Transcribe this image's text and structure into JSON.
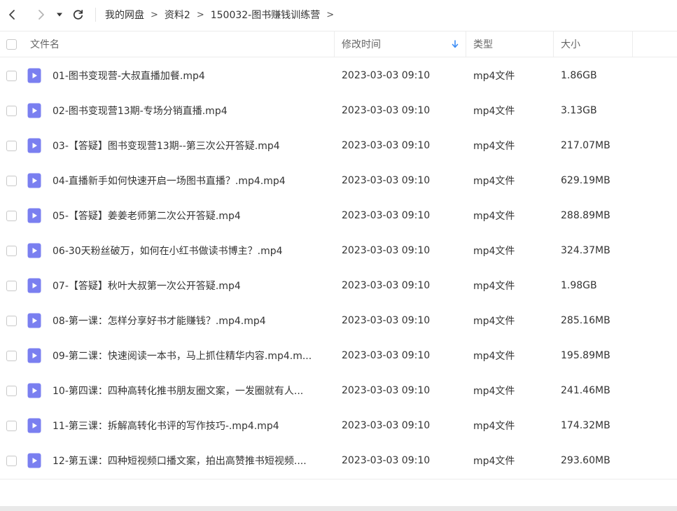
{
  "breadcrumb": [
    "我的网盘",
    "资料2",
    "150032-图书赚钱训练营"
  ],
  "breadcrumb_separator": ">",
  "columns": {
    "name": "文件名",
    "modified": "修改时间",
    "type": "类型",
    "size": "大小"
  },
  "sort": {
    "column": "modified",
    "direction": "descending",
    "indicator_color": "#3b8cf5"
  },
  "icon_color": "#7a7ff0",
  "files": [
    {
      "name": "01-图书变现营-大叔直播加餐.mp4",
      "modified": "2023-03-03 09:10",
      "type": "mp4文件",
      "size": "1.86GB"
    },
    {
      "name": "02-图书变现营13期-专场分销直播.mp4",
      "modified": "2023-03-03 09:10",
      "type": "mp4文件",
      "size": "3.13GB"
    },
    {
      "name": "03-【答疑】图书变现营13期--第三次公开答疑.mp4",
      "modified": "2023-03-03 09:10",
      "type": "mp4文件",
      "size": "217.07MB"
    },
    {
      "name": "04-直播新手如何快速开启一场图书直播？.mp4.mp4",
      "modified": "2023-03-03 09:10",
      "type": "mp4文件",
      "size": "629.19MB"
    },
    {
      "name": "05-【答疑】姜姜老师第二次公开答疑.mp4",
      "modified": "2023-03-03 09:10",
      "type": "mp4文件",
      "size": "288.89MB"
    },
    {
      "name": "06-30天粉丝破万，如何在小红书做读书博主？.mp4",
      "modified": "2023-03-03 09:10",
      "type": "mp4文件",
      "size": "324.37MB"
    },
    {
      "name": "07-【答疑】秋叶大叔第一次公开答疑.mp4",
      "modified": "2023-03-03 09:10",
      "type": "mp4文件",
      "size": "1.98GB"
    },
    {
      "name": "08-第一课：怎样分享好书才能赚钱？.mp4.mp4",
      "modified": "2023-03-03 09:10",
      "type": "mp4文件",
      "size": "285.16MB"
    },
    {
      "name": "09-第二课：快速阅读一本书，马上抓住精华内容.mp4.m...",
      "modified": "2023-03-03 09:10",
      "type": "mp4文件",
      "size": "195.89MB"
    },
    {
      "name": "10-第四课：四种高转化推书朋友圈文案，一发圈就有人...",
      "modified": "2023-03-03 09:10",
      "type": "mp4文件",
      "size": "241.46MB"
    },
    {
      "name": "11-第三课：拆解高转化书评的写作技巧-.mp4.mp4",
      "modified": "2023-03-03 09:10",
      "type": "mp4文件",
      "size": "174.32MB"
    },
    {
      "name": "12-第五课：四种短视频口播文案，拍出高赞推书短视频....",
      "modified": "2023-03-03 09:10",
      "type": "mp4文件",
      "size": "293.60MB"
    }
  ]
}
